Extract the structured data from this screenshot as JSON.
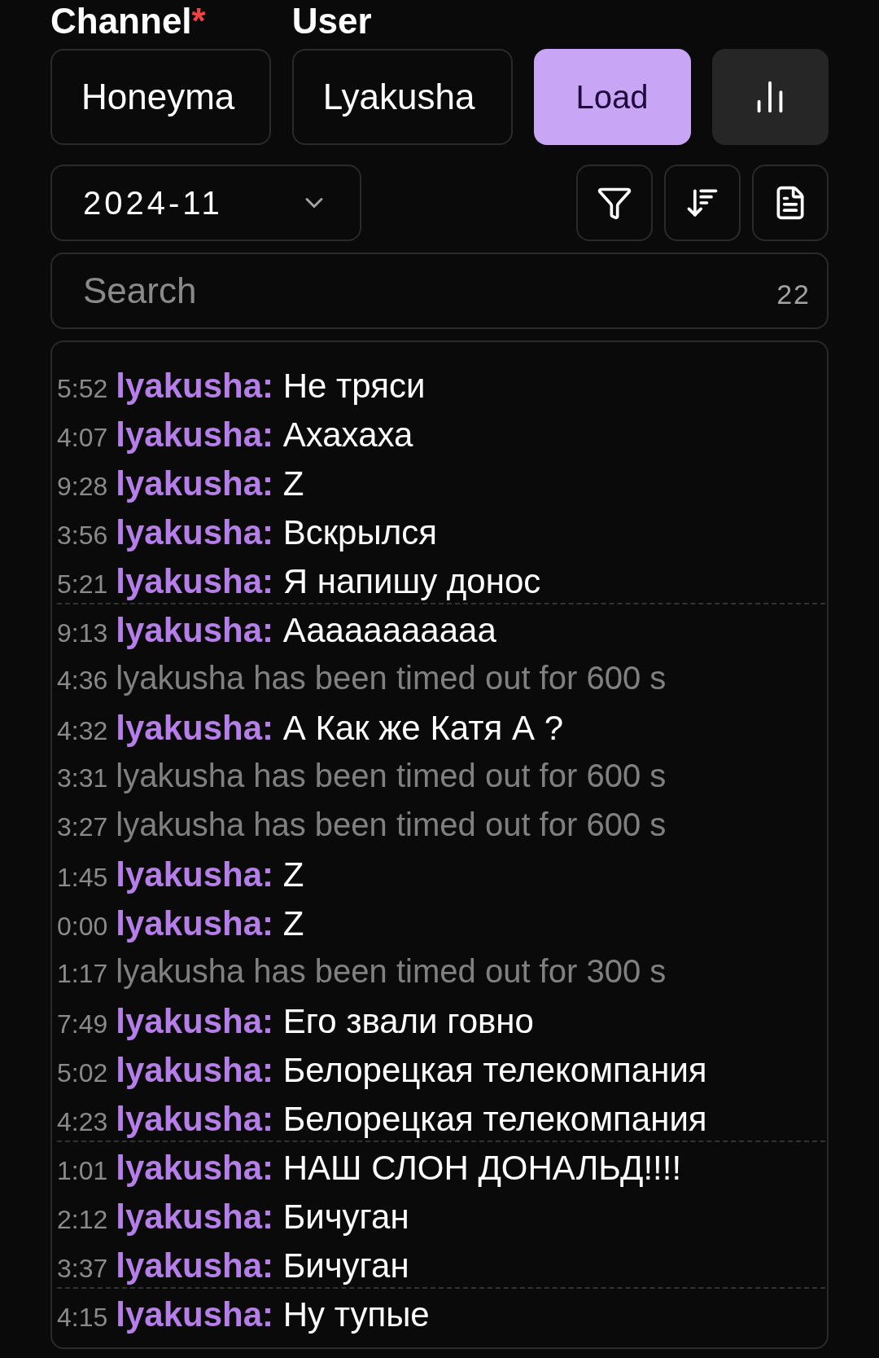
{
  "form": {
    "channel_label": "Channel",
    "required_mark": "*",
    "user_label": "User",
    "channel_value": "Honeyma",
    "user_value": "Lyakusha",
    "load_button": "Load"
  },
  "month_select": {
    "value": "2024-11"
  },
  "search": {
    "placeholder": "Search",
    "count": "22"
  },
  "messages": [
    {
      "kind": "message",
      "time": "5:52",
      "user": "lyakusha:",
      "text": "Не тряси",
      "divider_before": false
    },
    {
      "kind": "message",
      "time": "4:07",
      "user": "lyakusha:",
      "text": "Ахахаха",
      "divider_before": false
    },
    {
      "kind": "message",
      "time": "9:28",
      "user": "lyakusha:",
      "text": "Z",
      "divider_before": false
    },
    {
      "kind": "message",
      "time": "3:56",
      "user": "lyakusha:",
      "text": "Вскрылся",
      "divider_before": false
    },
    {
      "kind": "message",
      "time": "5:21",
      "user": "lyakusha:",
      "text": "Я напишу донос",
      "divider_before": false
    },
    {
      "kind": "message",
      "time": "9:13",
      "user": "lyakusha:",
      "text": "Ааааааааааа",
      "divider_before": true
    },
    {
      "kind": "system",
      "time": "4:36",
      "text": "lyakusha has been timed out for 600 s",
      "divider_before": false
    },
    {
      "kind": "message",
      "time": "4:32",
      "user": "lyakusha:",
      "text": "А Как же Катя А ?",
      "divider_before": false
    },
    {
      "kind": "system",
      "time": "3:31",
      "text": "lyakusha has been timed out for 600 s",
      "divider_before": false
    },
    {
      "kind": "system",
      "time": "3:27",
      "text": "lyakusha has been timed out for 600 s",
      "divider_before": false
    },
    {
      "kind": "message",
      "time": "1:45",
      "user": "lyakusha:",
      "text": "Z",
      "divider_before": false
    },
    {
      "kind": "message",
      "time": "0:00",
      "user": "lyakusha:",
      "text": "Z",
      "divider_before": false
    },
    {
      "kind": "system",
      "time": "1:17",
      "text": "lyakusha has been timed out for 300 s",
      "divider_before": false
    },
    {
      "kind": "message",
      "time": "7:49",
      "user": "lyakusha:",
      "text": "Его звали говно",
      "divider_before": false
    },
    {
      "kind": "message",
      "time": "5:02",
      "user": "lyakusha:",
      "text": "Белорецкая телекомпания",
      "divider_before": false
    },
    {
      "kind": "message",
      "time": "4:23",
      "user": "lyakusha:",
      "text": "Белорецкая телекомпания",
      "divider_before": false
    },
    {
      "kind": "message",
      "time": "1:01",
      "user": "lyakusha:",
      "text": "НАШ СЛОН ДОНАЛЬД!!!!",
      "divider_before": true
    },
    {
      "kind": "message",
      "time": "2:12",
      "user": "lyakusha:",
      "text": "Бичуган",
      "divider_before": false
    },
    {
      "kind": "message",
      "time": "3:37",
      "user": "lyakusha:",
      "text": "Бичуган",
      "divider_before": false
    },
    {
      "kind": "message",
      "time": "4:15",
      "user": "lyakusha:",
      "text": "Ну тупые",
      "divider_before": true
    }
  ]
}
